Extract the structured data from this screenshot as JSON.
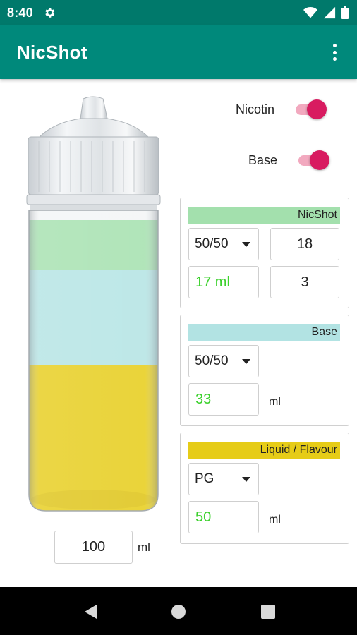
{
  "status_bar": {
    "time": "8:40"
  },
  "app_bar": {
    "title": "NicShot"
  },
  "toggles": {
    "nicotin": {
      "label": "Nicotin",
      "on": true
    },
    "base": {
      "label": "Base",
      "on": true
    }
  },
  "nicshot": {
    "header": "NicShot",
    "ratio": "50/50",
    "strength": "18",
    "volume_ml": "17 ml",
    "target": "3"
  },
  "base": {
    "header": "Base",
    "ratio": "50/50",
    "volume": "33",
    "unit": "ml"
  },
  "flavour": {
    "header": "Liquid / Flavour",
    "type": "PG",
    "volume": "50",
    "unit": "ml"
  },
  "bottle": {
    "total_volume": "100",
    "unit": "ml",
    "layers": [
      {
        "name": "NicShot",
        "share": 0.17
      },
      {
        "name": "Base",
        "share": 0.33
      },
      {
        "name": "Liquid / Flavour",
        "share": 0.5
      }
    ]
  },
  "colors": {
    "status_bar": "#00796b",
    "app_bar": "#00897b",
    "accent": "#d81b60",
    "nicshot": "#a3e0ad",
    "base": "#b2e3e3",
    "flavour": "#e6cc17",
    "computed_value": "#3dd12e"
  }
}
